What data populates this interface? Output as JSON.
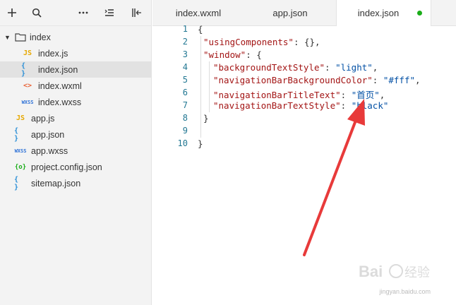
{
  "toolbar": {
    "icons": [
      "plus-icon",
      "search-icon",
      "more-icon",
      "collapse-icon",
      "split-icon"
    ]
  },
  "tree": [
    {
      "label": "index",
      "icon": "folder",
      "level": 0,
      "expanded": true
    },
    {
      "label": "index.js",
      "icon": "JS",
      "level": 1
    },
    {
      "label": "index.json",
      "icon": "{ }",
      "level": 1,
      "selected": true
    },
    {
      "label": "index.wxml",
      "icon": "< >",
      "level": 1
    },
    {
      "label": "index.wxss",
      "icon": "wxss",
      "level": 1
    },
    {
      "label": "app.js",
      "icon": "JS",
      "level": 0
    },
    {
      "label": "app.json",
      "icon": "{ }",
      "level": 0
    },
    {
      "label": "app.wxss",
      "icon": "wxss",
      "level": 0
    },
    {
      "label": "project.config.json",
      "icon": "{o}",
      "level": 0
    },
    {
      "label": "sitemap.json",
      "icon": "{ }",
      "level": 0
    }
  ],
  "tabs": [
    {
      "label": "index.wxml"
    },
    {
      "label": "app.json"
    },
    {
      "label": "index.json",
      "active": true,
      "modified": true
    }
  ],
  "editor": {
    "line_numbers": [
      "1",
      "2",
      "3",
      "4",
      "5",
      "6",
      "7",
      "8",
      "9",
      "10"
    ],
    "code": {
      "l1": "{",
      "l2_key": "\"usingComponents\"",
      "l2_rest": ": {},",
      "l3_key": "\"window\"",
      "l3_rest": ": {",
      "l4_key": "\"backgroundTextStyle\"",
      "l4_val": "\"light\"",
      "l5_key": "\"navigationBarBackgroundColor\"",
      "l5_val": "\"#fff\"",
      "l6_key": "\"navigationBarTitleText\"",
      "l6_val": "\"首页\"",
      "l7_key": "\"navigationBarTextStyle\"",
      "l7_val": "\"black\"",
      "l8": "}",
      "l10": "}"
    }
  },
  "colors": {
    "key": "#a31515",
    "string": "#0451a5",
    "line_number": "#237893",
    "modified_dot": "#1aad19",
    "arrow": "#e83a3a"
  },
  "watermark": {
    "text": "Baidu经验",
    "sub": "jingyan.baidu.com"
  }
}
